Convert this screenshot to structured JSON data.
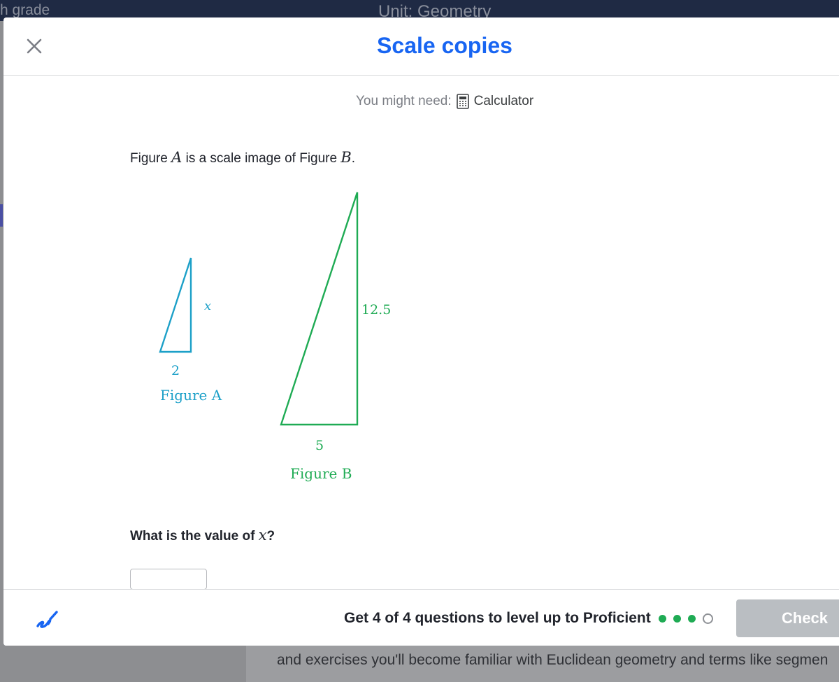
{
  "background": {
    "top_left_text": "h grade",
    "top_mid_text": "Unit: Geometry",
    "description": "and exercises you'll become familiar with Euclidean geometry and terms like segmen"
  },
  "modal": {
    "title": "Scale copies",
    "close_icon": "close-icon",
    "might_need_label": "You might need:",
    "tool_icon": "calculator-icon",
    "tool_label": "Calculator",
    "prompt": {
      "before": "Figure ",
      "fig_a": "A",
      "middle": " is a scale image of Figure ",
      "fig_b": "B",
      "after": "."
    },
    "figure_a": {
      "side_label": "x",
      "base_label": "2",
      "caption": "Figure A",
      "color": "#1ca0c8"
    },
    "figure_b": {
      "side_label": "12.5",
      "base_label": "5",
      "caption": "Figure B",
      "color": "#1fab54"
    },
    "question": {
      "before": "What is the value of ",
      "var": "x",
      "after": "?"
    },
    "answer_value": ""
  },
  "footer": {
    "scratchpad_icon": "scratchpad-icon",
    "progress_text": "Get 4 of 4 questions to level up to Proficient",
    "dots": [
      "filled",
      "filled",
      "filled",
      "empty"
    ],
    "check_label": "Check"
  },
  "colors": {
    "accent": "#1865f2",
    "figure_a": "#1ca0c8",
    "figure_b": "#1fab54",
    "progress": "#1fab54"
  }
}
